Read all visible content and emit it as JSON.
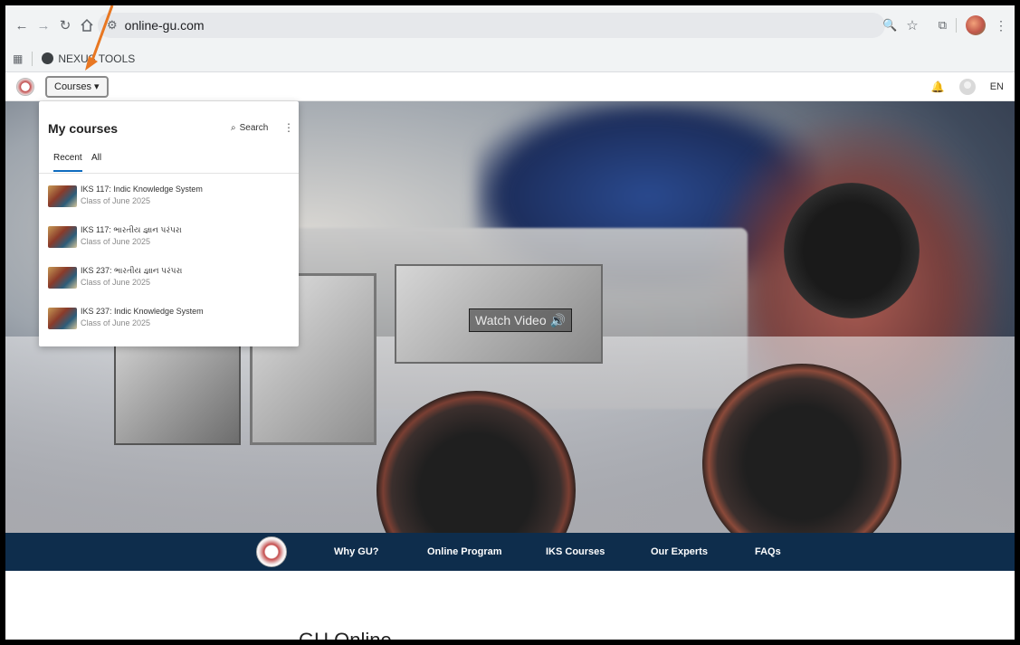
{
  "browser": {
    "url": "online-gu.com",
    "bookmark_label": "NEXUS TOOLS"
  },
  "site_header": {
    "courses_label": "Courses ▾",
    "language": "EN"
  },
  "dropdown": {
    "title": "My courses",
    "search_label": "Search",
    "tabs": [
      {
        "label": "Recent"
      },
      {
        "label": "All"
      }
    ],
    "items": [
      {
        "name": "IKS 117: Indic Knowledge System",
        "sub": "Class of June 2025"
      },
      {
        "name": "IKS 117: ભારતીય જ્ઞાન પરંપરા",
        "sub": "Class of June 2025"
      },
      {
        "name": "IKS 237: ભારતીય જ્ઞાન પરંપરા",
        "sub": "Class of June 2025"
      },
      {
        "name": "IKS 237: Indic Knowledge System",
        "sub": "Class of June 2025"
      }
    ]
  },
  "hero": {
    "watch_video_label": "Watch Video 🔊"
  },
  "site_nav": {
    "links": [
      {
        "label": "Why GU?"
      },
      {
        "label": "Online Program"
      },
      {
        "label": "IKS Courses"
      },
      {
        "label": "Our Experts"
      },
      {
        "label": "FAQs"
      }
    ]
  },
  "content": {
    "title": "GU Online"
  },
  "colors": {
    "nav_bg": "#0e2d4c",
    "annotation_arrow": "#e87722",
    "tab_accent": "#0f6cbf"
  }
}
